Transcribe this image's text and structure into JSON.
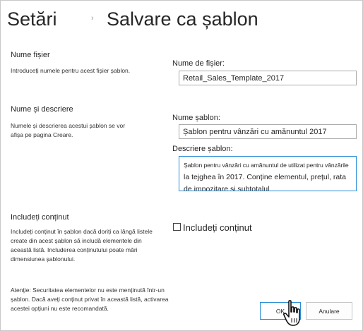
{
  "header": {
    "breadcrumb_parent": "Setări",
    "breadcrumb_separator": "›",
    "page_title": "Salvare ca șablon"
  },
  "file_name_section": {
    "title": "Nume fișier",
    "description": "Introduceți numele pentru acest fișier șablon.",
    "field_label": "Nume de fișier:",
    "field_value": "Retail_Sales_Template_2017"
  },
  "name_description_section": {
    "title": "Nume și descriere",
    "description": "Numele și descrierea acestui șablon se vor afișa pe pagina Creare.",
    "name_label": "Nume șablon:",
    "name_value": "Șablon pentru vânzări cu amănuntul 2017",
    "description_label": "Descriere șablon:",
    "description_value_line1": "Șablon pentru vânzări cu amănuntul de utilizat pentru vânzările",
    "description_value_rest": "la tejghea în 2017. Conține elementul, prețul, rata de impozitare și subtotalul"
  },
  "include_content_section": {
    "title": "Includeți conținut",
    "description": "Includeți conținut în șablon dacă doriți ca lângă listele create din acest șablon să includă elementele din această listă. Includerea conținutului poate mări dimensiunea șablonului.",
    "warning": "Atenție: Securitatea elementelor nu este menținută într-un șablon. Dacă aveți conținut privat în această listă, activarea acestei opțiuni nu este recomandată.",
    "checkbox_label": "Includeți conținut",
    "checkbox_checked": false
  },
  "actions": {
    "ok_label": "OK",
    "cancel_label": "Anulare"
  },
  "icons": {
    "cursor": "hand-pointer-icon"
  }
}
